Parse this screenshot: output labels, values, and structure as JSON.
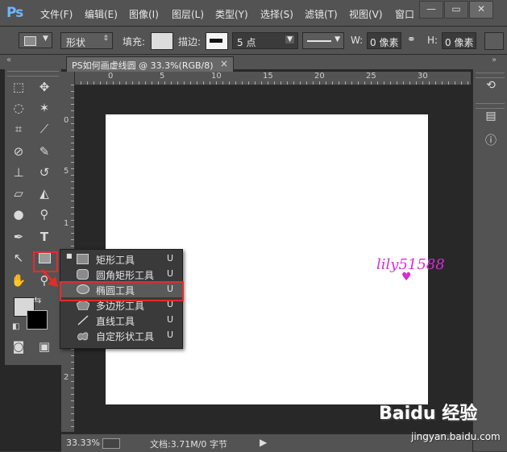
{
  "menubar": {
    "logo": "Ps",
    "items": [
      "文件(F)",
      "编辑(E)",
      "图像(I)",
      "图层(L)",
      "类型(Y)",
      "选择(S)",
      "滤镜(T)",
      "视图(V)",
      "窗口"
    ],
    "minimize": "—",
    "restore": "▭",
    "close": "✕"
  },
  "options": {
    "mode_value": "形状",
    "fill_label": "填充:",
    "stroke_label": "描边:",
    "stroke_width_value": "5 点",
    "w_label": "W:",
    "w_value": "0 像素",
    "h_label": "H:",
    "h_value": "0 像素"
  },
  "document": {
    "tab_label": "PS如何画虚线圆 @ 33.3%(RGB/8)",
    "tab_close": "×"
  },
  "ruler": {
    "top_ticks": [
      "0",
      "5",
      "10",
      "15",
      "20",
      "25",
      "30"
    ],
    "left_ticks": [
      "0",
      "5",
      "1",
      "1",
      "2",
      "2"
    ]
  },
  "flyout": {
    "items": [
      {
        "label": "矩形工具",
        "key": "U",
        "icon": "rectangle-icon",
        "current": true
      },
      {
        "label": "圆角矩形工具",
        "key": "U",
        "icon": "rounded-rectangle-icon"
      },
      {
        "label": "椭圆工具",
        "key": "U",
        "icon": "ellipse-icon",
        "selected": true
      },
      {
        "label": "多边形工具",
        "key": "U",
        "icon": "polygon-icon"
      },
      {
        "label": "直线工具",
        "key": "U",
        "icon": "line-icon"
      },
      {
        "label": "自定形状工具",
        "key": "U",
        "icon": "custom-shape-icon"
      }
    ]
  },
  "status": {
    "zoom": "33.33%",
    "doc_info": "文档:3.71M/0 字节"
  },
  "overlay": {
    "watermark": "lily51588",
    "baidu": "Baidu 经验",
    "baidu_sub": "jingyan.baidu.com"
  },
  "colors": {
    "highlight": "#e52b2b",
    "panel": "#535353",
    "workspace": "#282828"
  }
}
